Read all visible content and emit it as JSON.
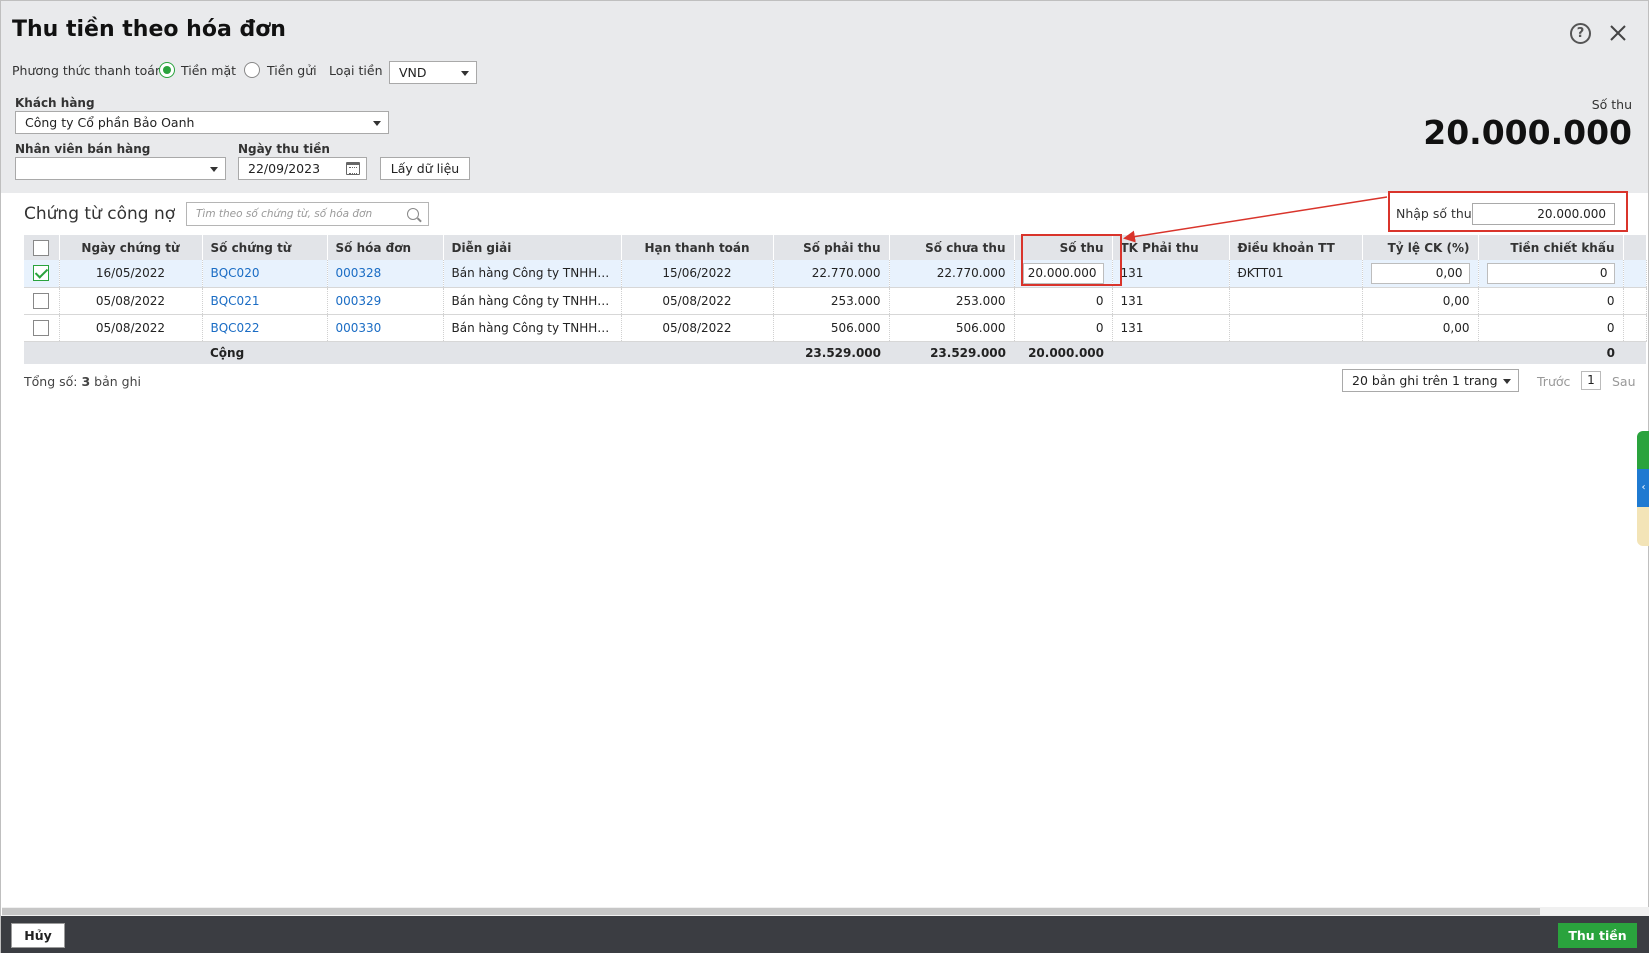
{
  "dialog": {
    "title": "Thu tiền theo hóa đơn"
  },
  "payment": {
    "method_label": "Phương thức thanh toán",
    "option_cash": "Tiền mặt",
    "option_deposit": "Tiền gửi",
    "selected": "Tiền mặt",
    "currency_label": "Loại tiền",
    "currency_value": "VND"
  },
  "filters": {
    "customer_label": "Khách hàng",
    "customer_value": "Công ty Cổ phần Bảo Oanh",
    "salesperson_label": "Nhân viên bán hàng",
    "salesperson_value": "",
    "date_label": "Ngày thu tiền",
    "date_value": "22/09/2023",
    "fetch_button": "Lấy dữ liệu"
  },
  "receipt": {
    "label": "Số thu",
    "amount": "20.000.000"
  },
  "section": {
    "title": "Chứng từ công nợ",
    "search_placeholder": "Tìm theo số chứng từ, số hóa đơn",
    "enter_label": "Nhập số thu",
    "enter_value": "20.000.000"
  },
  "table": {
    "columns": [
      "Ngày chứng từ",
      "Số chứng từ",
      "Số hóa đơn",
      "Diễn giải",
      "Hạn thanh toán",
      "Số phải thu",
      "Số chưa thu",
      "Số thu",
      "TK Phải thu",
      "Điều khoản TT",
      "Tỷ lệ CK (%)",
      "Tiền chiết khấu"
    ],
    "rows": [
      {
        "checked": true,
        "date": "16/05/2022",
        "voucher": "BQC020",
        "invoice": "000328",
        "desc": "Bán hàng Công ty TNHH Bảo Oanh",
        "due": "15/06/2022",
        "receivable": "22.770.000",
        "unpaid": "22.770.000",
        "received": "20.000.000",
        "account": "131",
        "terms": "ĐKTT01",
        "rate": "0,00",
        "discount": "0"
      },
      {
        "checked": false,
        "date": "05/08/2022",
        "voucher": "BQC021",
        "invoice": "000329",
        "desc": "Bán hàng Công ty TNHH Bảo Oanh",
        "due": "05/08/2022",
        "receivable": "253.000",
        "unpaid": "253.000",
        "received": "0",
        "account": "131",
        "terms": "",
        "rate": "0,00",
        "discount": "0"
      },
      {
        "checked": false,
        "date": "05/08/2022",
        "voucher": "BQC022",
        "invoice": "000330",
        "desc": "Bán hàng Công ty TNHH Bảo Oanh",
        "due": "05/08/2022",
        "receivable": "506.000",
        "unpaid": "506.000",
        "received": "0",
        "account": "131",
        "terms": "",
        "rate": "0,00",
        "discount": "0"
      }
    ],
    "total": {
      "label": "Cộng",
      "receivable": "23.529.000",
      "unpaid": "23.529.000",
      "received": "20.000.000",
      "discount": "0"
    }
  },
  "footer": {
    "count_prefix": "Tổng số:",
    "count_value": "3",
    "count_suffix": "bản ghi",
    "page_size": "20 bản ghi trên 1 trang",
    "prev": "Trước",
    "page": "1",
    "next": "Sau"
  },
  "actions": {
    "cancel": "Hủy",
    "submit": "Thu tiền"
  },
  "colors": {
    "accent_green": "#2aa33d",
    "link_blue": "#1a6cc4",
    "highlight_red": "#d9342b",
    "bottom_bar": "#3b3d42"
  }
}
